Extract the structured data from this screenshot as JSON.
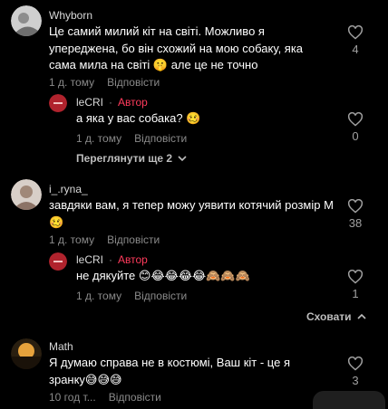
{
  "comments": [
    {
      "author": "Whyborn",
      "text": "Це самий милий кіт на світі. Можливо я упереджена, бо він схожий на мою собаку, яка сама мила на світі 🤫 але це не точно",
      "time": "1 д. тому",
      "reply_label": "Відповісти",
      "likes": "4",
      "replies": [
        {
          "author": "leCRI",
          "badge": "Автор",
          "text": "а яка у вас собака? 🥴",
          "time": "1 д. тому",
          "reply_label": "Відповісти",
          "likes": "0"
        }
      ],
      "view_more": "Переглянути ще 2"
    },
    {
      "author": "i_.ryna_",
      "text": "завдяки вам, я тепер можу уявити котячий розмір М🥴",
      "time": "1 д. тому",
      "reply_label": "Відповісти",
      "likes": "38",
      "replies": [
        {
          "author": "leCRI",
          "badge": "Автор",
          "text": "не дякуйте 😊😂😂😂😂🙈🙈🙈",
          "time": "1 д. тому",
          "reply_label": "Відповісти",
          "likes": "1"
        }
      ],
      "hide_label": "Сховати"
    },
    {
      "author": "Math",
      "text": "Я думаю справа не в костюмі, Ваш кіт - це я зранку😅😅😅",
      "time": "10 год т...",
      "reply_label": "Відповісти",
      "likes": "3"
    }
  ],
  "colors": {
    "badge": "#ff3b5c",
    "background": "#000000",
    "meta": "#8a8a8a"
  }
}
